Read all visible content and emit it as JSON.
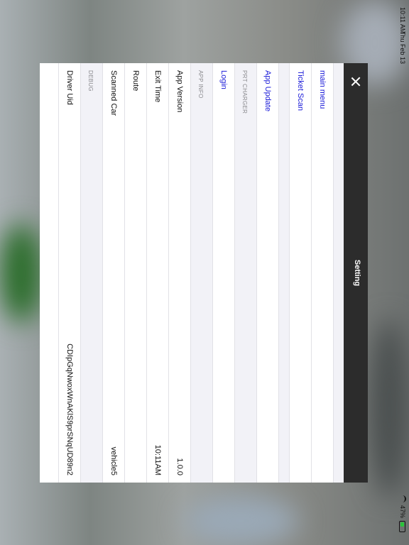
{
  "status_bar": {
    "time": "10:11 AM",
    "date": "Thu Feb 13",
    "battery": "47%"
  },
  "modal": {
    "title": "Setting",
    "menu_items": [
      {
        "label": "main menu"
      },
      {
        "label": "Ticket Scan"
      }
    ],
    "update_item": {
      "label": "App Update"
    },
    "prt_charger": {
      "header": "PRT CHARGER",
      "login_label": "Login"
    },
    "app_info": {
      "header": "APP INFO",
      "rows": [
        {
          "label": "App Version",
          "value": "1.0.0"
        },
        {
          "label": "Exit Time",
          "value": "10:11AM"
        },
        {
          "label": "Route",
          "value": ""
        },
        {
          "label": "Scanned Car",
          "value": "vehicle5"
        }
      ]
    },
    "debug": {
      "header": "DEBUG",
      "rows": [
        {
          "label": "Driver Uid",
          "value": "CDIpGqNwoxWnAKlS9prSNqUD89n2"
        }
      ]
    }
  },
  "colors": {
    "link": "#1a1ad8",
    "nav_bg": "#2c2c2c",
    "section_bg": "#f2f2f7",
    "battery_fill": "#2ac33a"
  }
}
